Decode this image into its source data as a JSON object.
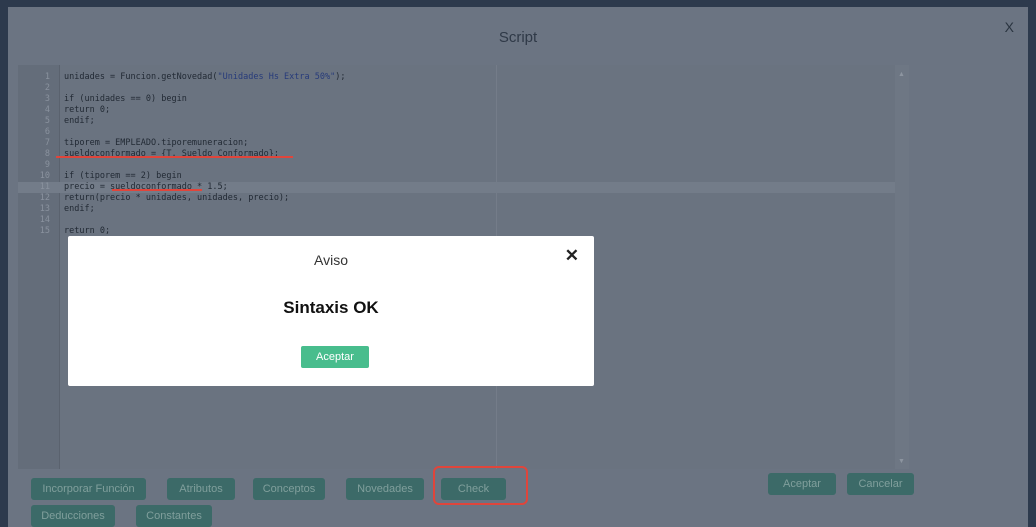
{
  "window": {
    "title": "Script",
    "close_label": "X"
  },
  "code_lines": [
    {
      "n": "1",
      "pre": "unidades = Funcion.getNovedad(",
      "str": "\"Unidades Hs Extra 50%\"",
      "post": ");"
    },
    {
      "n": "2",
      "pre": "",
      "str": "",
      "post": ""
    },
    {
      "n": "3",
      "pre": "if (unidades == 0) begin",
      "str": "",
      "post": ""
    },
    {
      "n": "4",
      "pre": "return 0;",
      "str": "",
      "post": ""
    },
    {
      "n": "5",
      "pre": "endif;",
      "str": "",
      "post": ""
    },
    {
      "n": "6",
      "pre": "",
      "str": "",
      "post": ""
    },
    {
      "n": "7",
      "pre": "tiporem = EMPLEADO.tiporemuneracion;",
      "str": "",
      "post": ""
    },
    {
      "n": "8",
      "pre": "sueldoconformado = {T. Sueldo Conformado};",
      "str": "",
      "post": ""
    },
    {
      "n": "9",
      "pre": "",
      "str": "",
      "post": ""
    },
    {
      "n": "10",
      "pre": "if (tiporem == 2) begin",
      "str": "",
      "post": ""
    },
    {
      "n": "11",
      "pre": "precio = sueldoconformado * 1.5;",
      "str": "",
      "post": ""
    },
    {
      "n": "12",
      "pre": "return(precio * unidades, unidades, precio);",
      "str": "",
      "post": ""
    },
    {
      "n": "13",
      "pre": "endif;",
      "str": "",
      "post": ""
    },
    {
      "n": "14",
      "pre": "",
      "str": "",
      "post": ""
    },
    {
      "n": "15",
      "pre": "return 0;",
      "str": "",
      "post": ""
    }
  ],
  "buttons": {
    "incorporar": "Incorporar Función",
    "atributos": "Atributos",
    "conceptos": "Conceptos",
    "novedades": "Novedades",
    "check": "Check",
    "deducciones": "Deducciones",
    "constantes": "Constantes",
    "aceptar": "Aceptar",
    "cancelar": "Cancelar"
  },
  "dialog": {
    "title": "Aviso",
    "close": "✕",
    "message": "Sintaxis OK",
    "ok": "Aceptar"
  }
}
